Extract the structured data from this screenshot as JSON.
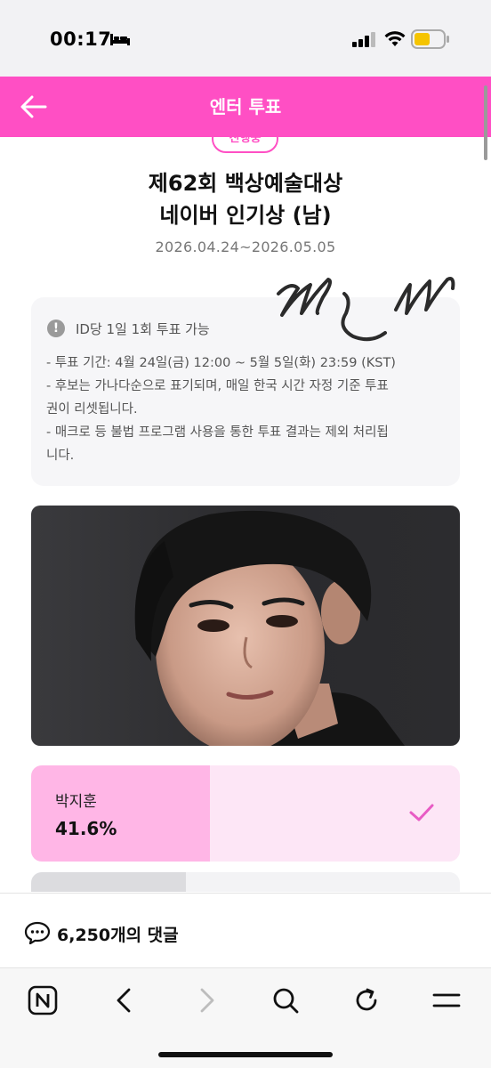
{
  "status_bar": {
    "time": "00:17",
    "icons": [
      "bed-icon",
      "signal-icon",
      "wifi-icon",
      "battery-icon"
    ],
    "battery_color": "#f5c400"
  },
  "header": {
    "title": "엔터 투표",
    "background_color": "#ff4fc4",
    "back_icon": "arrow-left-icon"
  },
  "vote": {
    "badge": "진행중",
    "title_line1": "제62회 백상예술대상",
    "title_line2": "네이버 인기상 (남)",
    "period": "2026.04.24~2026.05.05"
  },
  "info": {
    "heading": "ID당 1일 1회 투표 가능",
    "lines": [
      "- 투표 기간: 4월 24일(금) 12:00 ~ 5월 5일(화) 23:59 (KST)",
      "- 후보는 가나다순으로 표기되며, 매일 한국 시간 자정 기준 투표",
      "권이 리셋됩니다.",
      "- 매크로 등 불법 프로그램 사용을 통한 투표 결과는 제외 처리됩",
      "니다."
    ]
  },
  "candidates": [
    {
      "name": "박지훈",
      "percent_label": "41.6%",
      "percent": 41.6,
      "selected": true
    },
    {
      "name": "",
      "percent_label": "",
      "percent": 36,
      "selected": false
    }
  ],
  "comments": {
    "label": "6,250개의 댓글"
  },
  "toolbar": {
    "icons": [
      "naver-n-icon",
      "back-arrow-icon",
      "forward-arrow-icon",
      "search-icon",
      "reload-icon",
      "menu-icon"
    ]
  },
  "colors": {
    "accent": "#ff4fc4",
    "candidate_fill": "#ffb6e6",
    "candidate_bg": "#fde6f6",
    "check": "#e85bc4"
  }
}
